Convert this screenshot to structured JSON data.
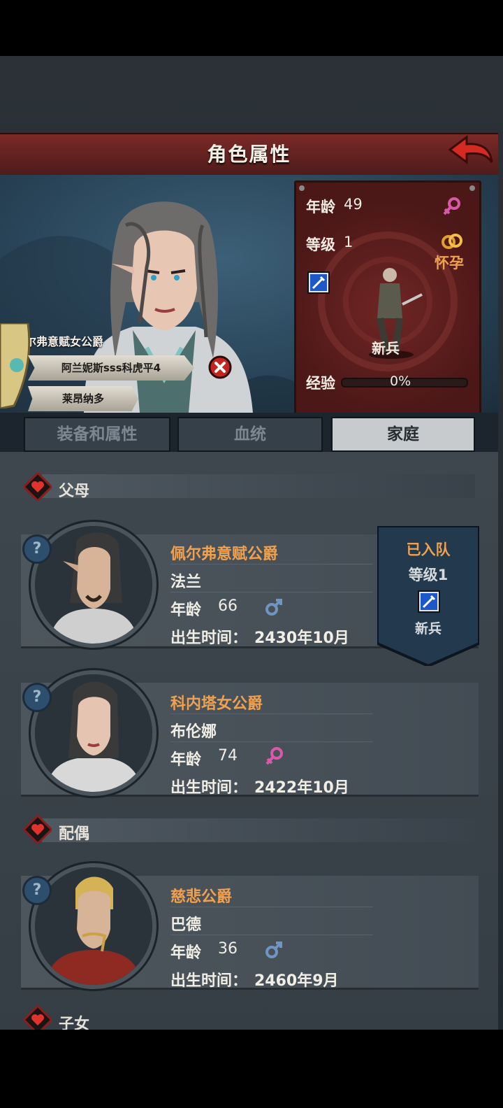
{
  "header": {
    "title": "角色属性"
  },
  "character": {
    "title_plate": "佩尔弗意赋女公爵",
    "nickname": "阿兰妮斯sss科虎平4",
    "house": "莱昂纳多",
    "age_label": "年龄",
    "age": "49",
    "level_label": "等级",
    "level": "1",
    "status": "怀孕",
    "class": "新兵",
    "exp_label": "经验",
    "exp_value": "0%",
    "exp_fraction": 0
  },
  "tabs": [
    {
      "label": "装备和属性",
      "active": false
    },
    {
      "label": "血统",
      "active": false
    },
    {
      "label": "家庭",
      "active": true
    }
  ],
  "family": {
    "parents_title": "父母",
    "spouse_title": "配偶",
    "children_title": "子女",
    "age_label": "年龄",
    "birth_label": "出生时间：",
    "father": {
      "title": "佩尔弗意赋公爵",
      "name": "法兰",
      "age": "66",
      "gender": "male",
      "birth": "2430年10月"
    },
    "mother": {
      "title": "科内塔女公爵",
      "name": "布伦娜",
      "age": "74",
      "gender": "female",
      "birth": "2422年10月"
    },
    "spouse": {
      "title": "慈悲公爵",
      "name": "巴德",
      "age": "36",
      "gender": "male",
      "birth": "2460年9月"
    }
  },
  "party_banner": {
    "status": "已入队",
    "level_text": "等级1",
    "class": "新兵"
  },
  "colors": {
    "female": "#d65aa7",
    "male": "#6f95c2",
    "title_orange": "#f0a150",
    "header_red": "#6b2523"
  },
  "icons": [
    "back-arrow-icon",
    "female-icon",
    "male-icon",
    "rings-icon",
    "sword-skill-icon",
    "close-icon",
    "question-icon",
    "heart-icon",
    "shield-icon"
  ]
}
